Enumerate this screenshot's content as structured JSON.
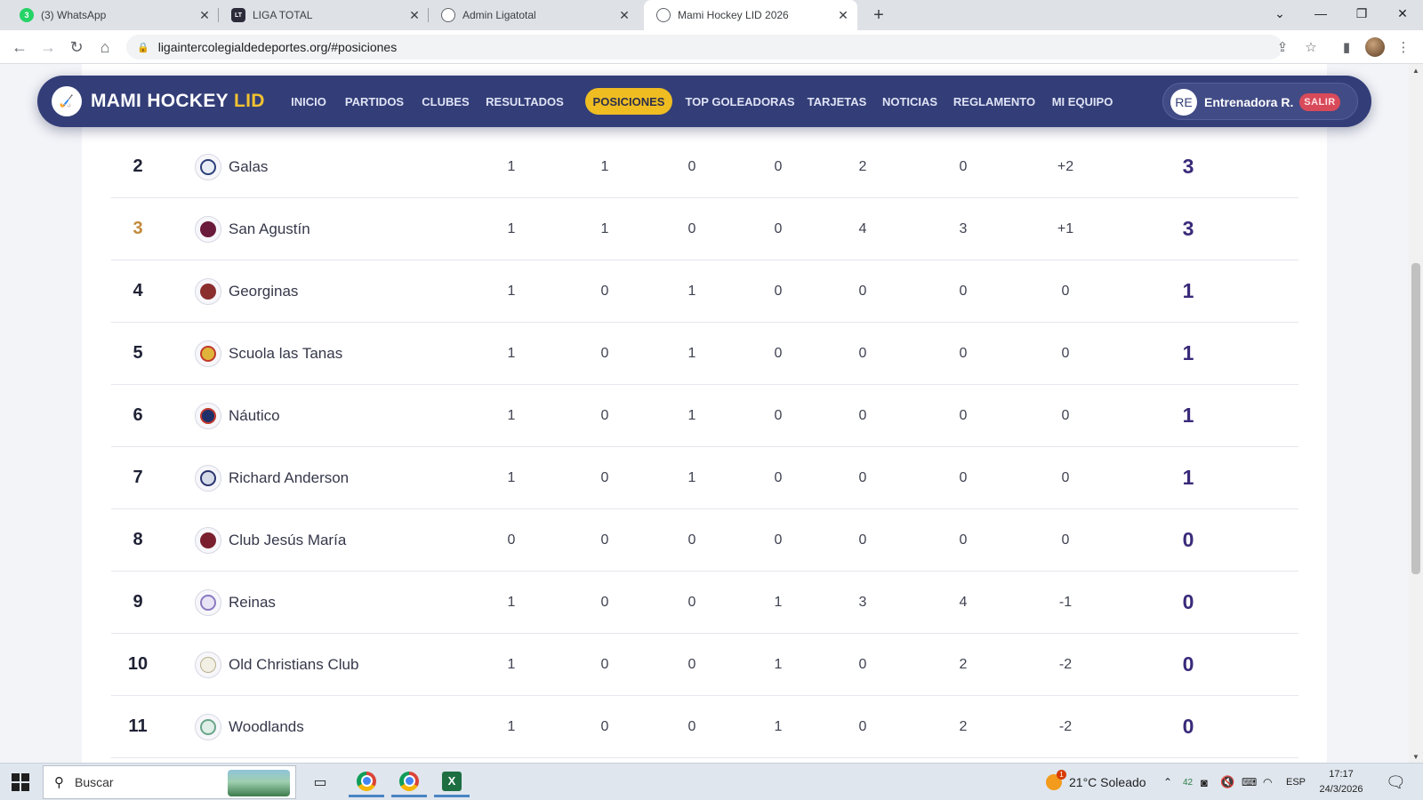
{
  "browser": {
    "tabs": [
      {
        "title": "(3) WhatsApp",
        "favicon_text": "3",
        "favicon": "whatsapp-icon"
      },
      {
        "title": "LIGA TOTAL",
        "favicon_text": "LT",
        "favicon": "liga-total-icon"
      },
      {
        "title": "Admin Ligatotal",
        "favicon": "globe-icon"
      },
      {
        "title": "Mami Hockey LID 2026",
        "favicon": "globe-icon",
        "active": true
      }
    ],
    "url": "ligaintercolegialdedeportes.org/#posiciones"
  },
  "site": {
    "brand_main": "MAMI HOCKEY",
    "brand_accent": "LID",
    "nav": [
      {
        "label": "INICIO"
      },
      {
        "label": "PARTIDOS"
      },
      {
        "label": "CLUBES"
      },
      {
        "label": "RESULTADOS"
      },
      {
        "label": "POSICIONES",
        "active": true
      },
      {
        "label": "TOP GOLEADORAS"
      },
      {
        "label": "TARJETAS"
      },
      {
        "label": "NOTICIAS"
      },
      {
        "label": "REGLAMENTO"
      },
      {
        "label": "MI EQUIPO"
      }
    ],
    "user": {
      "initials": "RE",
      "name": "Entrenadora R.",
      "logout": "SALIR"
    },
    "colors": {
      "header": "#333e78",
      "accent": "#efbd22",
      "points": "#3a2a7a",
      "bronze": "#c3893a"
    }
  },
  "standings": [
    {
      "pos": "2",
      "team": "Galas",
      "pj": "1",
      "pg": "1",
      "pe": "0",
      "pp": "0",
      "gf": "2",
      "gc": "0",
      "dg": "+2",
      "pts": "3"
    },
    {
      "pos": "3",
      "team": "San Agustín",
      "pj": "1",
      "pg": "1",
      "pe": "0",
      "pp": "0",
      "gf": "4",
      "gc": "3",
      "dg": "+1",
      "pts": "3"
    },
    {
      "pos": "4",
      "team": "Georginas",
      "pj": "1",
      "pg": "0",
      "pe": "1",
      "pp": "0",
      "gf": "0",
      "gc": "0",
      "dg": "0",
      "pts": "1"
    },
    {
      "pos": "5",
      "team": "Scuola las Tanas",
      "pj": "1",
      "pg": "0",
      "pe": "1",
      "pp": "0",
      "gf": "0",
      "gc": "0",
      "dg": "0",
      "pts": "1"
    },
    {
      "pos": "6",
      "team": "Náutico",
      "pj": "1",
      "pg": "0",
      "pe": "1",
      "pp": "0",
      "gf": "0",
      "gc": "0",
      "dg": "0",
      "pts": "1"
    },
    {
      "pos": "7",
      "team": "Richard Anderson",
      "pj": "1",
      "pg": "0",
      "pe": "1",
      "pp": "0",
      "gf": "0",
      "gc": "0",
      "dg": "0",
      "pts": "1"
    },
    {
      "pos": "8",
      "team": "Club Jesús María",
      "pj": "0",
      "pg": "0",
      "pe": "0",
      "pp": "0",
      "gf": "0",
      "gc": "0",
      "dg": "0",
      "pts": "0"
    },
    {
      "pos": "9",
      "team": "Reinas",
      "pj": "1",
      "pg": "0",
      "pe": "0",
      "pp": "1",
      "gf": "3",
      "gc": "4",
      "dg": "-1",
      "pts": "0"
    },
    {
      "pos": "10",
      "team": "Old Christians Club",
      "pj": "1",
      "pg": "0",
      "pe": "0",
      "pp": "1",
      "gf": "0",
      "gc": "2",
      "dg": "-2",
      "pts": "0"
    },
    {
      "pos": "11",
      "team": "Woodlands",
      "pj": "1",
      "pg": "0",
      "pe": "0",
      "pp": "1",
      "gf": "0",
      "gc": "2",
      "dg": "-2",
      "pts": "0"
    }
  ],
  "taskbar": {
    "search_placeholder": "Buscar",
    "weather": "21°C  Soleado",
    "weather_badge": "1",
    "tray_count": "42",
    "language": "ESP",
    "time": "17:17",
    "date": "24/3/2026"
  }
}
